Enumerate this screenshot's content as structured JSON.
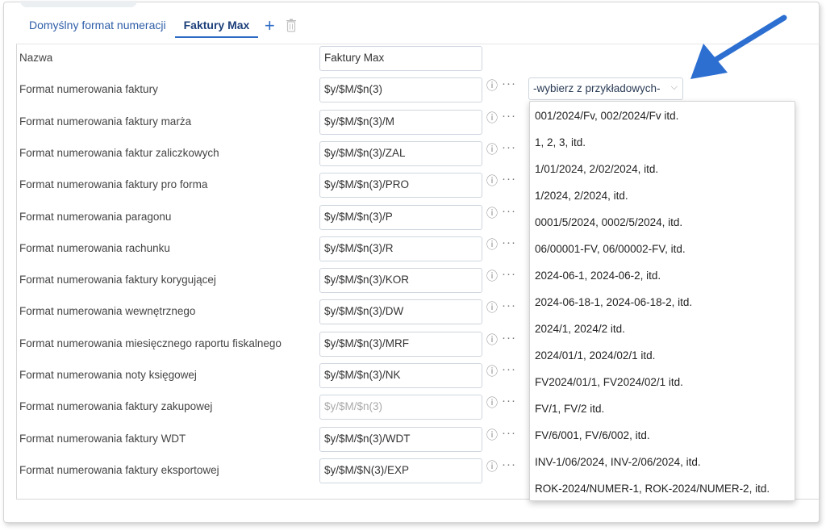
{
  "tabs": {
    "items": [
      {
        "label": "Domyślny format numeracji"
      },
      {
        "label": "Faktury Max"
      }
    ],
    "add_label": "+"
  },
  "form": {
    "rows": [
      {
        "label": "Nazwa",
        "value": "Faktury Max"
      },
      {
        "label": "Format numerowania faktury",
        "value": "$y/$M/$n(3)"
      },
      {
        "label": "Format numerowania faktury marża",
        "value": "$y/$M/$n(3)/M"
      },
      {
        "label": "Format numerowania faktur zaliczkowych",
        "value": "$y/$M/$n(3)/ZAL"
      },
      {
        "label": "Format numerowania faktury pro forma",
        "value": "$y/$M/$n(3)/PRO"
      },
      {
        "label": "Format numerowania paragonu",
        "value": "$y/$M/$n(3)/P"
      },
      {
        "label": "Format numerowania rachunku",
        "value": "$y/$M/$n(3)/R"
      },
      {
        "label": "Format numerowania faktury korygującej",
        "value": "$y/$M/$n(3)/KOR"
      },
      {
        "label": "Format numerowania wewnętrznego",
        "value": "$y/$M/$n(3)/DW"
      },
      {
        "label": "Format numerowania miesięcznego raportu fiskalnego",
        "value": "$y/$M/$n(3)/MRF"
      },
      {
        "label": "Format numerowania noty księgowej",
        "value": "$y/$M/$n(3)/NK"
      },
      {
        "label": "Format numerowania faktury zakupowej",
        "placeholder": "$y/$M/$n(3)"
      },
      {
        "label": "Format numerowania faktury WDT",
        "value": "$y/$M/$n(3)/WDT"
      },
      {
        "label": "Format numerowania faktury eksportowej",
        "value": "$y/$M/$N(3)/EXP"
      }
    ],
    "info_glyph": "ⓘ",
    "more_glyph": "···"
  },
  "examples_select": {
    "selected": "-wybierz z przykładowych-",
    "chevron": "⌵",
    "options": [
      "001/2024/Fv, 002/2024/Fv itd.",
      "1, 2, 3, itd.",
      "1/01/2024, 2/02/2024, itd.",
      "1/2024, 2/2024, itd.",
      "0001/5/2024, 0002/5/2024, itd.",
      "06/00001-FV, 06/00002-FV, itd.",
      "2024-06-1, 2024-06-2, itd.",
      "2024-06-18-1, 2024-06-18-2, itd.",
      "2024/1, 2024/2 itd.",
      "2024/01/1, 2024/02/1 itd.",
      "FV2024/01/1, FV2024/02/1 itd.",
      "FV/1, FV/2 itd.",
      "FV/6/001, FV/6/002, itd.",
      "INV-1/06/2024, INV-2/06/2024, itd.",
      "ROK-2024/NUMER-1, ROK-2024/NUMER-2, itd."
    ]
  },
  "colors": {
    "accent": "#2e6bc4",
    "arrow": "#2c6fd1"
  },
  "icons": {
    "trash": "trash-icon",
    "info": "info-icon",
    "more": "more-icon",
    "add": "plus-icon",
    "annotation": "arrow-pointer"
  }
}
